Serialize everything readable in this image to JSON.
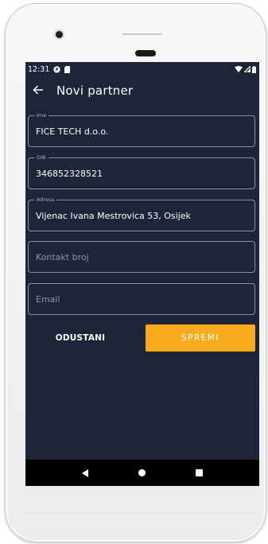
{
  "status_bar": {
    "time": "12:31",
    "icons": [
      "notification-p-icon",
      "sd-card-icon",
      "wifi-icon",
      "signal-icon",
      "battery-icon"
    ]
  },
  "app_bar": {
    "back_icon": "arrow-back-icon",
    "title": "Novi partner"
  },
  "form": {
    "ime": {
      "label": "Ime",
      "value": "FICE TECH d.o.o."
    },
    "oib": {
      "label": "OIB",
      "value": "346852328521"
    },
    "adresa": {
      "label": "Adresa",
      "value": "Vijenac Ivana Mestrovica 53, Osijek"
    },
    "kontakt": {
      "placeholder": "Kontakt broj",
      "value": ""
    },
    "email": {
      "placeholder": "Email",
      "value": ""
    }
  },
  "actions": {
    "cancel_label": "ODUSTANI",
    "save_label": "SPREMI"
  },
  "colors": {
    "screen_background": "#1e2538",
    "accent": "#f6ac1c",
    "field_border": "#8a91a3",
    "nav_bar": "#000000"
  },
  "nav_bar": {
    "icons": [
      "nav-back-icon",
      "nav-home-icon",
      "nav-recents-icon"
    ]
  }
}
